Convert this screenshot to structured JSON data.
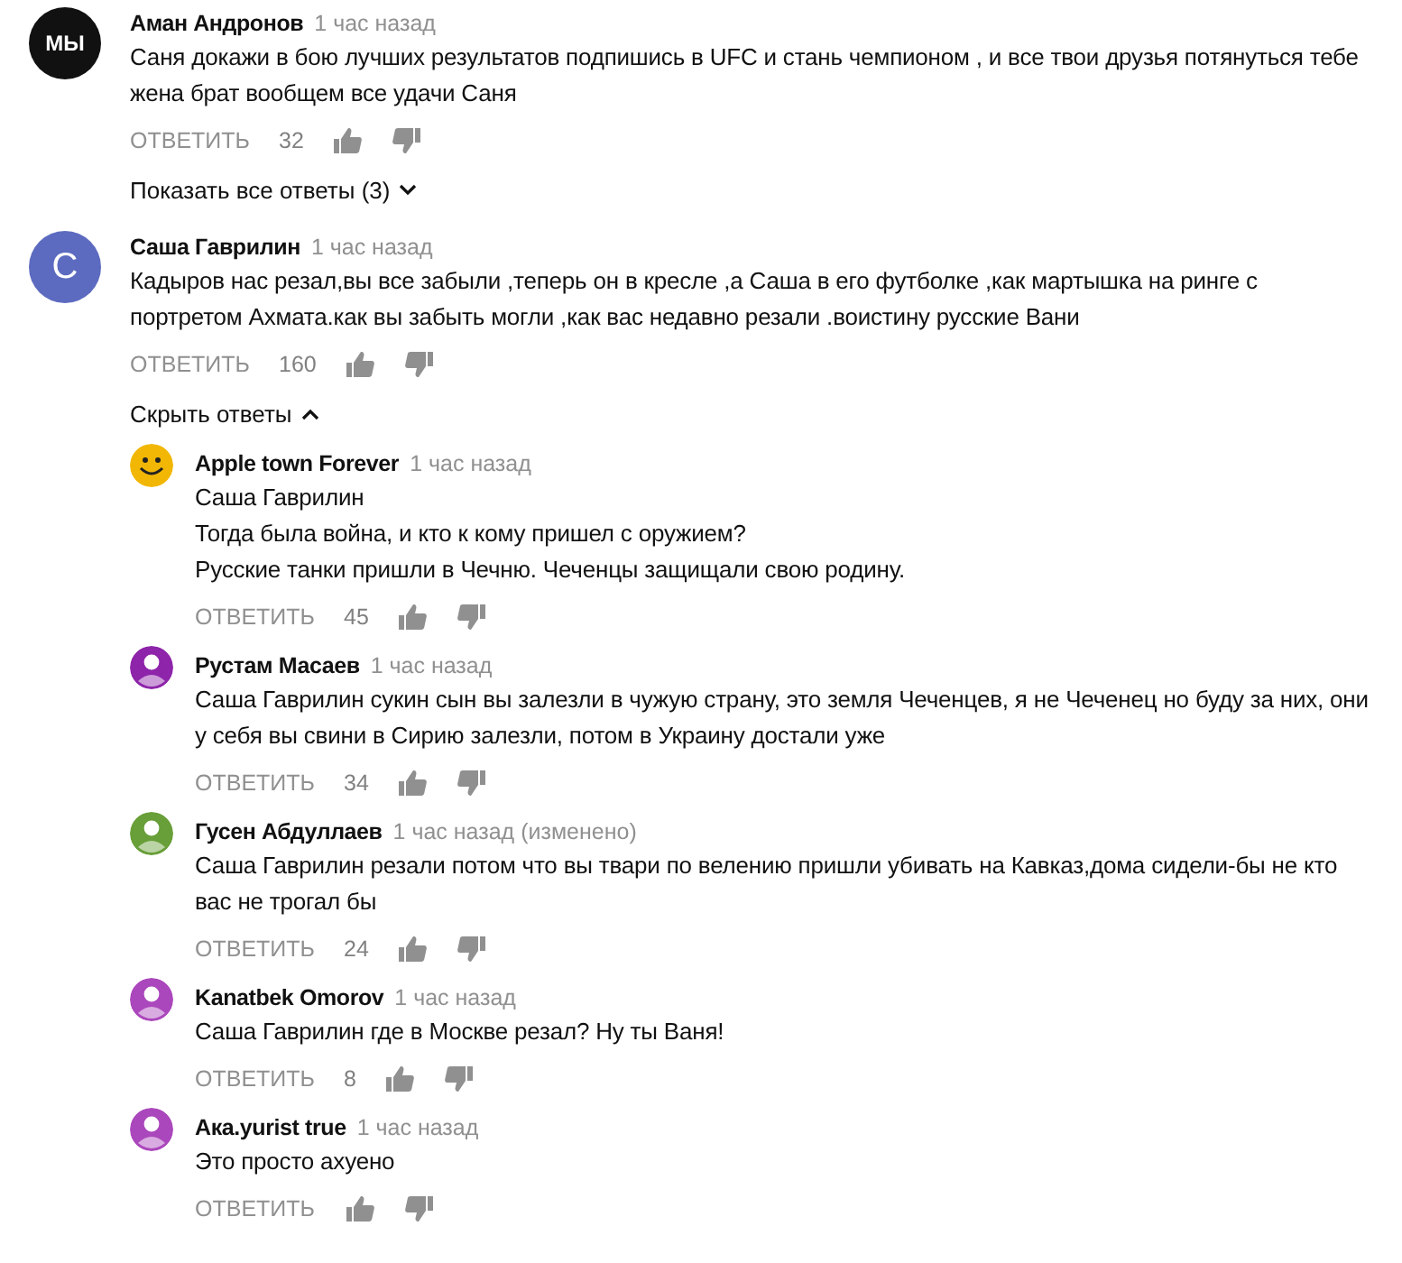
{
  "comments": [
    {
      "author": "Аман Андронов",
      "time": "1 час назад",
      "avatar": {
        "kind": "logo",
        "text": "МЫ"
      },
      "lines": [
        "Саня докажи в бою лучших результатов подпишись в UFC и стань чемпионом , и все твои друзья потянуться тебе",
        "жена брат вообщем все удачи Саня"
      ],
      "reply_label": "ОТВЕТИТЬ",
      "likes": "32",
      "replies_toggle": {
        "label": "Показать все ответы (3)",
        "expanded": false
      }
    },
    {
      "author": "Саша Гаврилин",
      "time": "1 час назад",
      "avatar": {
        "kind": "letter",
        "text": "С",
        "color": "#5c6bc0"
      },
      "lines": [
        "Кадыров нас резал,вы все забыли ,теперь он в кресле ,а Саша в его футболке ,как мартышка на ринге с",
        "портретом Ахмата.как вы забыть могли ,как вас недавно резали .воистину русские Вани"
      ],
      "reply_label": "ОТВЕТИТЬ",
      "likes": "160",
      "replies_toggle": {
        "label": "Скрыть ответы",
        "expanded": true
      },
      "replies": [
        {
          "author": "Apple town Forever",
          "time": "1 час назад",
          "avatar": {
            "kind": "smiley"
          },
          "lines": [
            "Саша Гаврилин",
            "Тогда была война, и кто к кому пришел с оружием?",
            "Русские танки пришли в Чечню. Чеченцы защищали свою родину."
          ],
          "reply_label": "ОТВЕТИТЬ",
          "likes": "45"
        },
        {
          "author": "Рустам Масаев",
          "time": "1 час назад",
          "avatar": {
            "kind": "person",
            "color": "#8e24aa"
          },
          "lines": [
            "Саша Гаврилин сукин сын вы залезли в чужую страну, это земля Чеченцев, я не Чеченец но буду за них, они",
            "у себя вы свини в Сирию залезли, потом в Украину достали уже"
          ],
          "reply_label": "ОТВЕТИТЬ",
          "likes": "34"
        },
        {
          "author": "Гусен Абдуллаев",
          "time": "1 час назад (изменено)",
          "avatar": {
            "kind": "person",
            "color": "#689f38"
          },
          "lines": [
            "Саша Гаврилин резали потом что вы твари по велению пришли убивать на Кавказ,дома сидели-бы не кто",
            "вас не трогал бы"
          ],
          "reply_label": "ОТВЕТИТЬ",
          "likes": "24"
        },
        {
          "author": "Kanatbek Omorov",
          "time": "1 час назад",
          "avatar": {
            "kind": "person",
            "color": "#ab47bc"
          },
          "lines": [
            "Саша Гаврилин где в Москве резал? Ну ты Ваня!"
          ],
          "reply_label": "ОТВЕТИТЬ",
          "likes": "8"
        },
        {
          "author": "Aка.yurist true",
          "time": "1 час назад",
          "avatar": {
            "kind": "person",
            "color": "#ab47bc"
          },
          "lines": [
            "Это просто ахуено"
          ],
          "reply_label": "ОТВЕТИТЬ"
        }
      ]
    }
  ]
}
